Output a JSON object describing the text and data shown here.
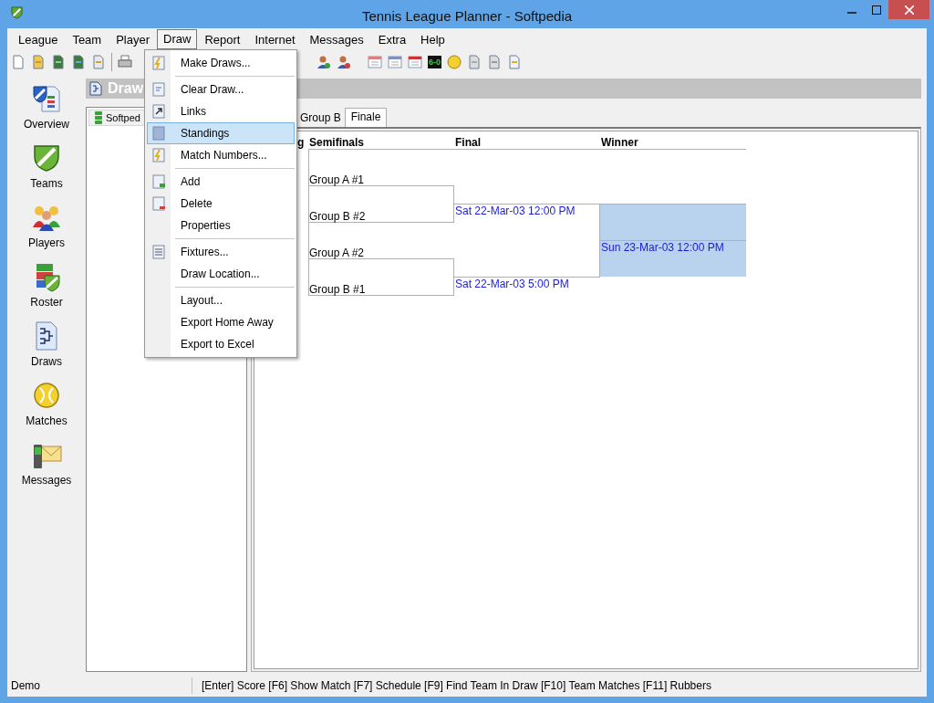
{
  "window": {
    "title": "Tennis League Planner - Softpedia"
  },
  "menu_bar": [
    {
      "label": "League",
      "selected": false
    },
    {
      "label": "Team",
      "selected": false
    },
    {
      "label": "Player",
      "selected": false
    },
    {
      "label": "Draw",
      "selected": true
    },
    {
      "label": "Report",
      "selected": false
    },
    {
      "label": "Internet",
      "selected": false
    },
    {
      "label": "Messages",
      "selected": false
    },
    {
      "label": "Extra",
      "selected": false
    },
    {
      "label": "Help",
      "selected": false
    }
  ],
  "toolbar": {
    "score_icon_text": "6-0"
  },
  "sidebar": [
    {
      "label": "Overview"
    },
    {
      "label": "Teams"
    },
    {
      "label": "Players"
    },
    {
      "label": "Roster"
    },
    {
      "label": "Draws"
    },
    {
      "label": "Matches"
    },
    {
      "label": "Messages"
    }
  ],
  "header": {
    "title": "Draw"
  },
  "tree": {
    "items": [
      {
        "label": "Softped"
      }
    ]
  },
  "tabs": [
    {
      "label": "Group B",
      "selected": false
    },
    {
      "label": "Finale",
      "selected": true
    }
  ],
  "bracket": {
    "columns": [
      "g",
      "Semifinals",
      "Final",
      "Winner"
    ],
    "semifinal_entries": [
      "Group A #1",
      "Group B #2",
      "Group A #2",
      "Group B #1"
    ],
    "final_times": [
      "Sat 22-Mar-03 12:00 PM",
      "Sat 22-Mar-03 5:00 PM"
    ],
    "winner_time": "Sun 23-Mar-03 12:00 PM"
  },
  "draw_menu": [
    {
      "kind": "item",
      "label": "Make Draws...",
      "selected": false
    },
    {
      "kind": "separator"
    },
    {
      "kind": "item",
      "label": "Clear Draw...",
      "selected": false
    },
    {
      "kind": "item",
      "label": "Links",
      "selected": false
    },
    {
      "kind": "item",
      "label": "Standings",
      "selected": true
    },
    {
      "kind": "item",
      "label": "Match Numbers...",
      "selected": false
    },
    {
      "kind": "separator"
    },
    {
      "kind": "item",
      "label": "Add",
      "selected": false
    },
    {
      "kind": "item",
      "label": "Delete",
      "selected": false
    },
    {
      "kind": "item",
      "label": "Properties",
      "selected": false
    },
    {
      "kind": "separator"
    },
    {
      "kind": "item",
      "label": "Fixtures...",
      "selected": false
    },
    {
      "kind": "item",
      "label": "Draw Location...",
      "selected": false
    },
    {
      "kind": "separator"
    },
    {
      "kind": "item",
      "label": "Layout...",
      "selected": false
    },
    {
      "kind": "item",
      "label": "Export Home Away",
      "selected": false
    },
    {
      "kind": "item",
      "label": "Export to Excel",
      "selected": false
    }
  ],
  "status_bar": {
    "mode": "Demo",
    "hint": "[Enter] Score [F6] Show Match [F7] Schedule [F9] Find Team In Draw [F10] Team Matches [F11] Rubbers"
  }
}
